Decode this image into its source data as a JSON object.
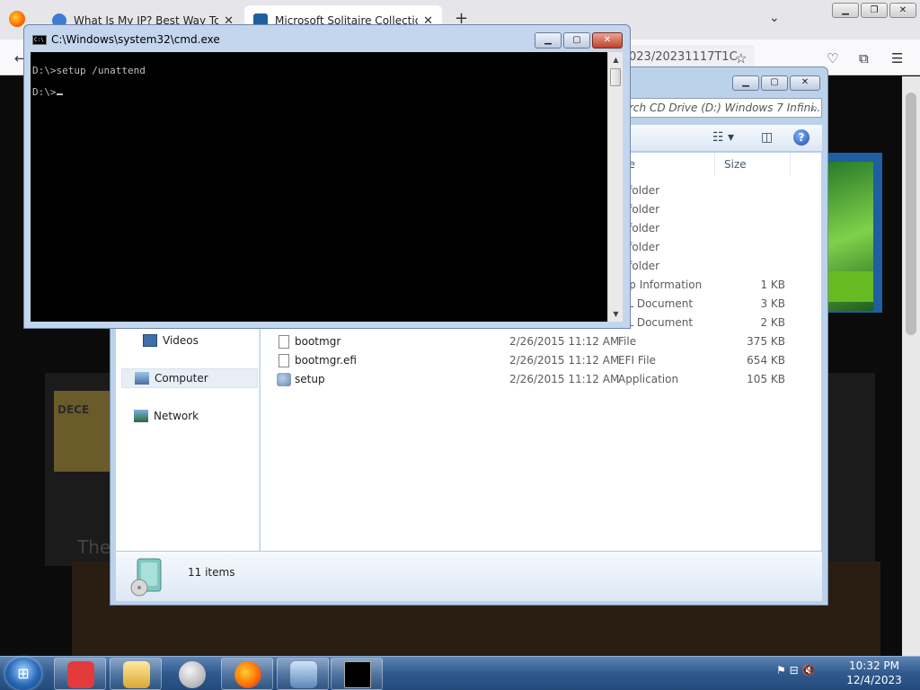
{
  "browser": {
    "tabs": [
      {
        "title": "What Is My IP? Best Way To Che"
      },
      {
        "title": "Microsoft Solitaire Collection"
      }
    ],
    "close_glyph": "✕",
    "new_tab_glyph": "+",
    "list_tabs_glyph": "⌄",
    "url_fragment": "023/20231117T1C",
    "content_text": "The",
    "calendar_text": "DECE"
  },
  "explorer": {
    "search_placeholder": "rch CD Drive (D:) Windows 7 Infini...",
    "columns": {
      "type": "pe",
      "size": "Size"
    },
    "nav": [
      {
        "label": "Videos"
      },
      {
        "label": "Computer"
      },
      {
        "label": "Network"
      }
    ],
    "files": [
      {
        "name": "",
        "date": "",
        "type": "e folder",
        "size": ""
      },
      {
        "name": "",
        "date": "",
        "type": "e folder",
        "size": ""
      },
      {
        "name": "",
        "date": "",
        "type": "e folder",
        "size": ""
      },
      {
        "name": "",
        "date": "",
        "type": "e folder",
        "size": ""
      },
      {
        "name": "",
        "date": "",
        "type": "e folder",
        "size": ""
      },
      {
        "name": "",
        "date": "",
        "type": "tup Information",
        "size": "1 KB"
      },
      {
        "name": "",
        "date": "",
        "type": "ML Document",
        "size": "3 KB"
      },
      {
        "name": "",
        "date": "",
        "type": "ML Document",
        "size": "2 KB"
      },
      {
        "name": "bootmgr",
        "date": "2/26/2015 11:12 AM",
        "type": "File",
        "size": "375 KB"
      },
      {
        "name": "bootmgr.efi",
        "date": "2/26/2015 11:12 AM",
        "type": "EFI File",
        "size": "654 KB"
      },
      {
        "name": "setup",
        "date": "2/26/2015 11:12 AM",
        "type": "Application",
        "size": "105 KB"
      }
    ],
    "status_count": "11 items"
  },
  "cmd": {
    "title": "C:\\Windows\\system32\\cmd.exe",
    "line1": "D:\\>setup /unattend",
    "line2": "D:\\>"
  },
  "taskbar": {
    "time": "10:32 PM",
    "date": "12/4/2023"
  },
  "colors": {
    "cmd_background": "#000000",
    "cmd_text": "#c0c0c0",
    "taskbar": "#2f5a8e",
    "close_button": "#c2412a"
  }
}
